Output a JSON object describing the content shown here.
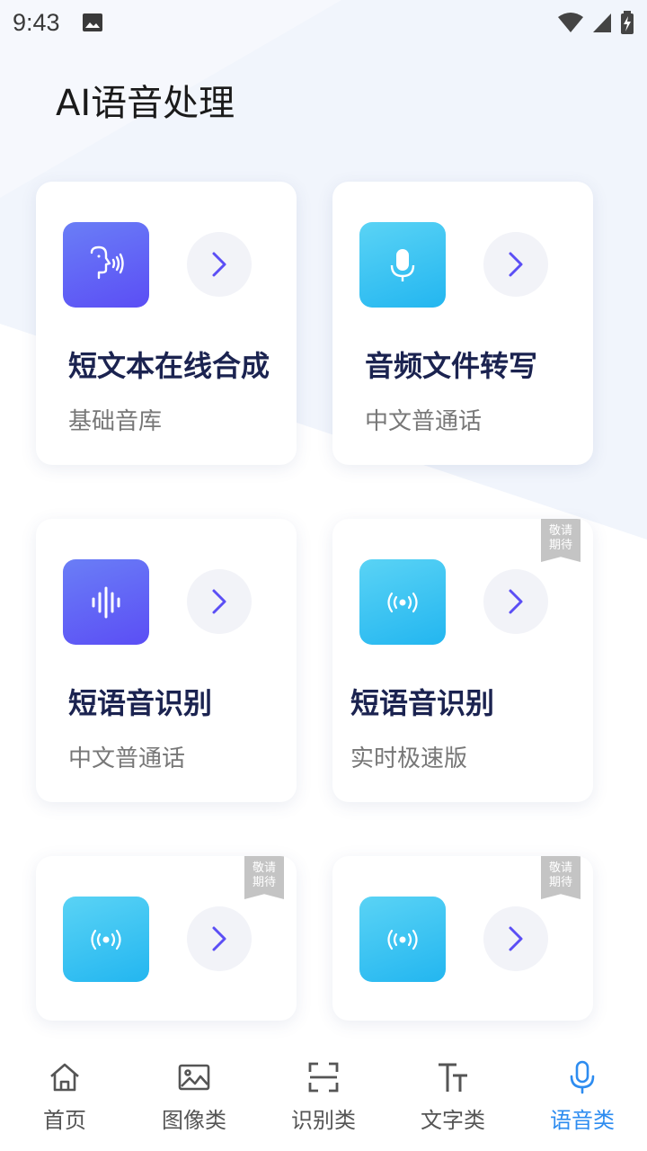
{
  "status_bar": {
    "time": "9:43"
  },
  "page_title": "AI语音处理",
  "cards": [
    {
      "title": "短文本在线合成",
      "subtitle": "基础音库"
    },
    {
      "title": "音频文件转写",
      "subtitle": "中文普通话"
    },
    {
      "title": "短语音识别",
      "subtitle": "中文普通话"
    },
    {
      "title": "短语音识别",
      "subtitle": "实时极速版",
      "ribbon": "敬请期待"
    },
    {
      "title": "",
      "subtitle": "",
      "ribbon": "敬请期待"
    },
    {
      "title": "",
      "subtitle": "",
      "ribbon": "敬请期待"
    }
  ],
  "ribbon_line1": "敬请",
  "ribbon_line2": "期待",
  "nav": {
    "items": [
      {
        "label": "首页",
        "icon": "home-icon"
      },
      {
        "label": "图像类",
        "icon": "image-icon"
      },
      {
        "label": "识别类",
        "icon": "scan-icon"
      },
      {
        "label": "文字类",
        "icon": "text-icon"
      },
      {
        "label": "语音类",
        "icon": "microphone-icon"
      }
    ],
    "active_index": 4
  },
  "colors": {
    "accent": "#2d8cf0",
    "title_dark": "#1b2350",
    "tile_purple": "#5b4ef5",
    "tile_cyan": "#23b6f0",
    "arrow": "#5b4ef5"
  }
}
